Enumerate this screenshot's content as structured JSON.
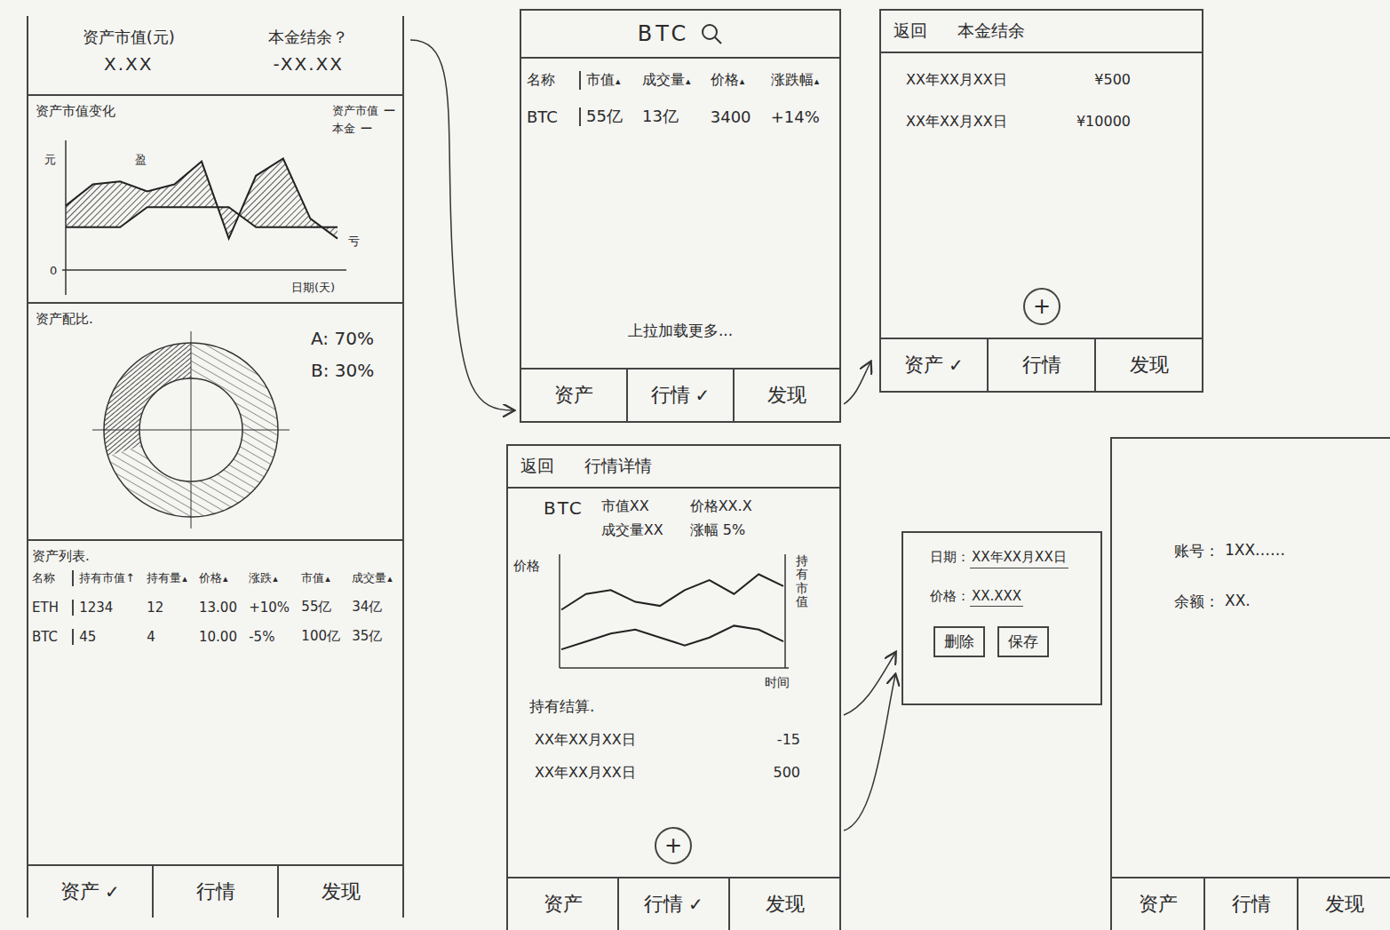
{
  "assets_screen": {
    "summary": [
      {
        "label": "资产市值(元)",
        "value": "X.XX"
      },
      {
        "label": "本金结余？",
        "value": "-XX.XX"
      }
    ],
    "chart": {
      "title": "资产市值变化",
      "y_unit": "元",
      "y_zero": "0",
      "x_label": "日期(天)",
      "profit_label": "盈",
      "loss_label": "亏",
      "series": [
        {
          "name": "资产市值",
          "legend_mark": "—",
          "values": [
            45,
            60,
            62,
            55,
            60,
            76,
            22,
            66,
            78,
            36,
            22
          ]
        },
        {
          "name": "本金",
          "legend_mark": "—",
          "values": [
            30,
            30,
            30,
            44,
            44,
            44,
            44,
            30,
            30,
            30,
            30
          ]
        }
      ]
    },
    "allocation": {
      "title": "资产配比.",
      "slices": [
        {
          "label": "A: 70%",
          "value": 70
        },
        {
          "label": "B: 30%",
          "value": 30
        }
      ]
    },
    "list": {
      "title": "资产列表.",
      "columns": [
        {
          "label": "名称"
        },
        {
          "label": "持有市值↑"
        },
        {
          "label": "持有量",
          "sort": "▴"
        },
        {
          "label": "价格",
          "sort": "▴"
        },
        {
          "label": "涨跌",
          "sort": "▴"
        },
        {
          "label": "市值",
          "sort": "▴"
        },
        {
          "label": "成交量",
          "sort": "▴"
        }
      ],
      "rows": [
        {
          "cells": [
            "ETH",
            "1234",
            "12",
            "13.00",
            "+10%",
            "55亿",
            "34亿"
          ]
        },
        {
          "cells": [
            "BTC",
            "45",
            "4",
            "10.00",
            "-5%",
            "100亿",
            "35亿"
          ]
        }
      ]
    },
    "tab_bar": {
      "check": "✓",
      "tabs": [
        {
          "label": "资产",
          "selected": true
        },
        {
          "label": "行情",
          "selected": false
        },
        {
          "label": "发现",
          "selected": false
        }
      ]
    }
  },
  "market_screen": {
    "search": {
      "text": "BTC"
    },
    "columns": [
      {
        "label": "名称"
      },
      {
        "label": "市值",
        "sort": "▴"
      },
      {
        "label": "成交量",
        "sort": "▴"
      },
      {
        "label": "价格",
        "sort": "▴"
      },
      {
        "label": "涨跌幅",
        "sort": "▴"
      }
    ],
    "rows": [
      {
        "cells": [
          "BTC",
          "55亿",
          "13亿",
          "3400",
          "+14%"
        ]
      }
    ],
    "load_more": "上拉加载更多...",
    "tab_bar": {
      "check": "✓",
      "tabs": [
        {
          "label": "资产",
          "selected": false
        },
        {
          "label": "行情",
          "selected": true
        },
        {
          "label": "发现",
          "selected": false
        }
      ]
    }
  },
  "detail_screen": {
    "back": "返回",
    "title": "行情详情",
    "coin": "BTC",
    "stats": [
      "市值XX",
      "价格XX.X",
      "成交量XX",
      "涨幅 5%"
    ],
    "chart": {
      "y_label": "价格",
      "right_label": "持有市值",
      "x_label": "时间",
      "series": [
        {
          "name": "价格",
          "values": [
            40,
            48,
            50,
            44,
            42,
            50,
            55,
            48,
            58,
            52
          ]
        },
        {
          "name": "持有市值",
          "values": [
            20,
            24,
            28,
            30,
            26,
            22,
            26,
            32,
            30,
            24
          ]
        }
      ]
    },
    "holdings": {
      "title": "持有结算.",
      "rows": [
        {
          "date": "XX年XX月XX日",
          "amount": "-15"
        },
        {
          "date": "XX年XX月XX日",
          "amount": "500"
        }
      ]
    },
    "add": "+",
    "tab_bar": {
      "check": "✓",
      "tabs": [
        {
          "label": "资产",
          "selected": false
        },
        {
          "label": "行情",
          "selected": true
        },
        {
          "label": "发现",
          "selected": false
        }
      ]
    }
  },
  "principal_screen": {
    "back": "返回",
    "title": "本金结余",
    "rows": [
      {
        "date": "XX年XX月XX日",
        "amount": "¥500"
      },
      {
        "date": "XX年XX月XX日",
        "amount": "¥10000"
      }
    ],
    "add": "+",
    "tab_bar": {
      "check": "✓",
      "tabs": [
        {
          "label": "资产",
          "selected": true
        },
        {
          "label": "行情",
          "selected": false
        },
        {
          "label": "发现",
          "selected": false
        }
      ]
    }
  },
  "edit_dialog": {
    "fields": [
      {
        "label": "日期：",
        "value": "XX年XX月XX日"
      },
      {
        "label": "价格：",
        "value": "XX.XXX"
      }
    ],
    "buttons": [
      "删除",
      "保存"
    ]
  },
  "discover_screen": {
    "fields": [
      {
        "label": "账号：",
        "value": "1XX……"
      },
      {
        "label": "余额：",
        "value": "XX."
      }
    ],
    "tab_bar": {
      "check": "✓",
      "tabs": [
        {
          "label": "资产",
          "selected": false
        },
        {
          "label": "行情",
          "selected": false
        },
        {
          "label": "发现",
          "selected": false
        }
      ]
    }
  }
}
